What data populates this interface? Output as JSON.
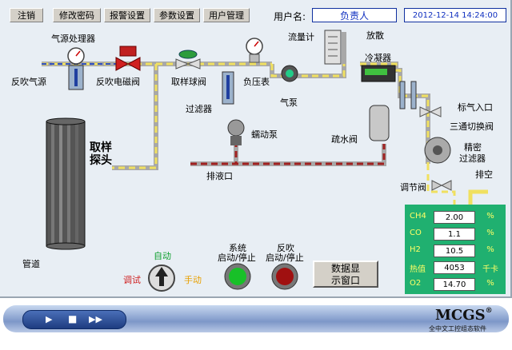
{
  "toolbar": {
    "logout": "注销",
    "change_password": "修改密码",
    "alarm_settings": "报警设置",
    "param_settings": "参数设置",
    "user_management": "用户管理",
    "username_label": "用户名:",
    "username_value": "负责人",
    "datetime": "2012-12-14 14:24:00"
  },
  "labels": {
    "air_processor": "气源处理器",
    "blowback_air": "反吹气源",
    "blowback_valve": "反吹电磁阀",
    "sampling_ball_valve": "取样球阀",
    "negative_pressure_gauge": "负压表",
    "flowmeter": "流量计",
    "vent": "放散",
    "condenser": "冷凝器",
    "air_pump": "气泵",
    "filter": "过滤器",
    "peristaltic_pump": "蠕动泵",
    "drain_valve": "疏水阀",
    "std_gas_inlet": "标气入口",
    "three_way_valve": "三通切换阀",
    "fine_filter_1": "精密",
    "fine_filter_2": "过滤器",
    "exhaust": "排空",
    "regulating_valve": "调节阀",
    "drain_outlet": "排液口",
    "sampling_probe_1": "取样",
    "sampling_probe_2": "探头",
    "pipeline": "管道",
    "mode_auto": "自动",
    "mode_debug": "调试",
    "mode_manual": "手动",
    "system_label_1": "系统",
    "system_label_2": "启动/停止",
    "blowback_label_1": "反吹",
    "blowback_label_2": "启动/停止",
    "data_button_1": "数据显",
    "data_button_2": "示窗口"
  },
  "gas_data": [
    {
      "name": "CH4",
      "value": "2.00",
      "unit": "%"
    },
    {
      "name": "CO",
      "value": "1.1",
      "unit": "%"
    },
    {
      "name": "H2",
      "value": "10.5",
      "unit": "%"
    },
    {
      "name": "热值",
      "value": "4053",
      "unit": "千卡"
    },
    {
      "name": "O2",
      "value": "14.70",
      "unit": "%"
    }
  ],
  "brand": {
    "name": "MCGS",
    "sub": "全中文工控组态软件",
    "reg": "®"
  },
  "colors": {
    "pipe_yellow": "#f0e060",
    "pipe_red": "#a02020",
    "panel_green": "#20b070",
    "status_green": "#18c028",
    "status_red": "#a01010"
  }
}
